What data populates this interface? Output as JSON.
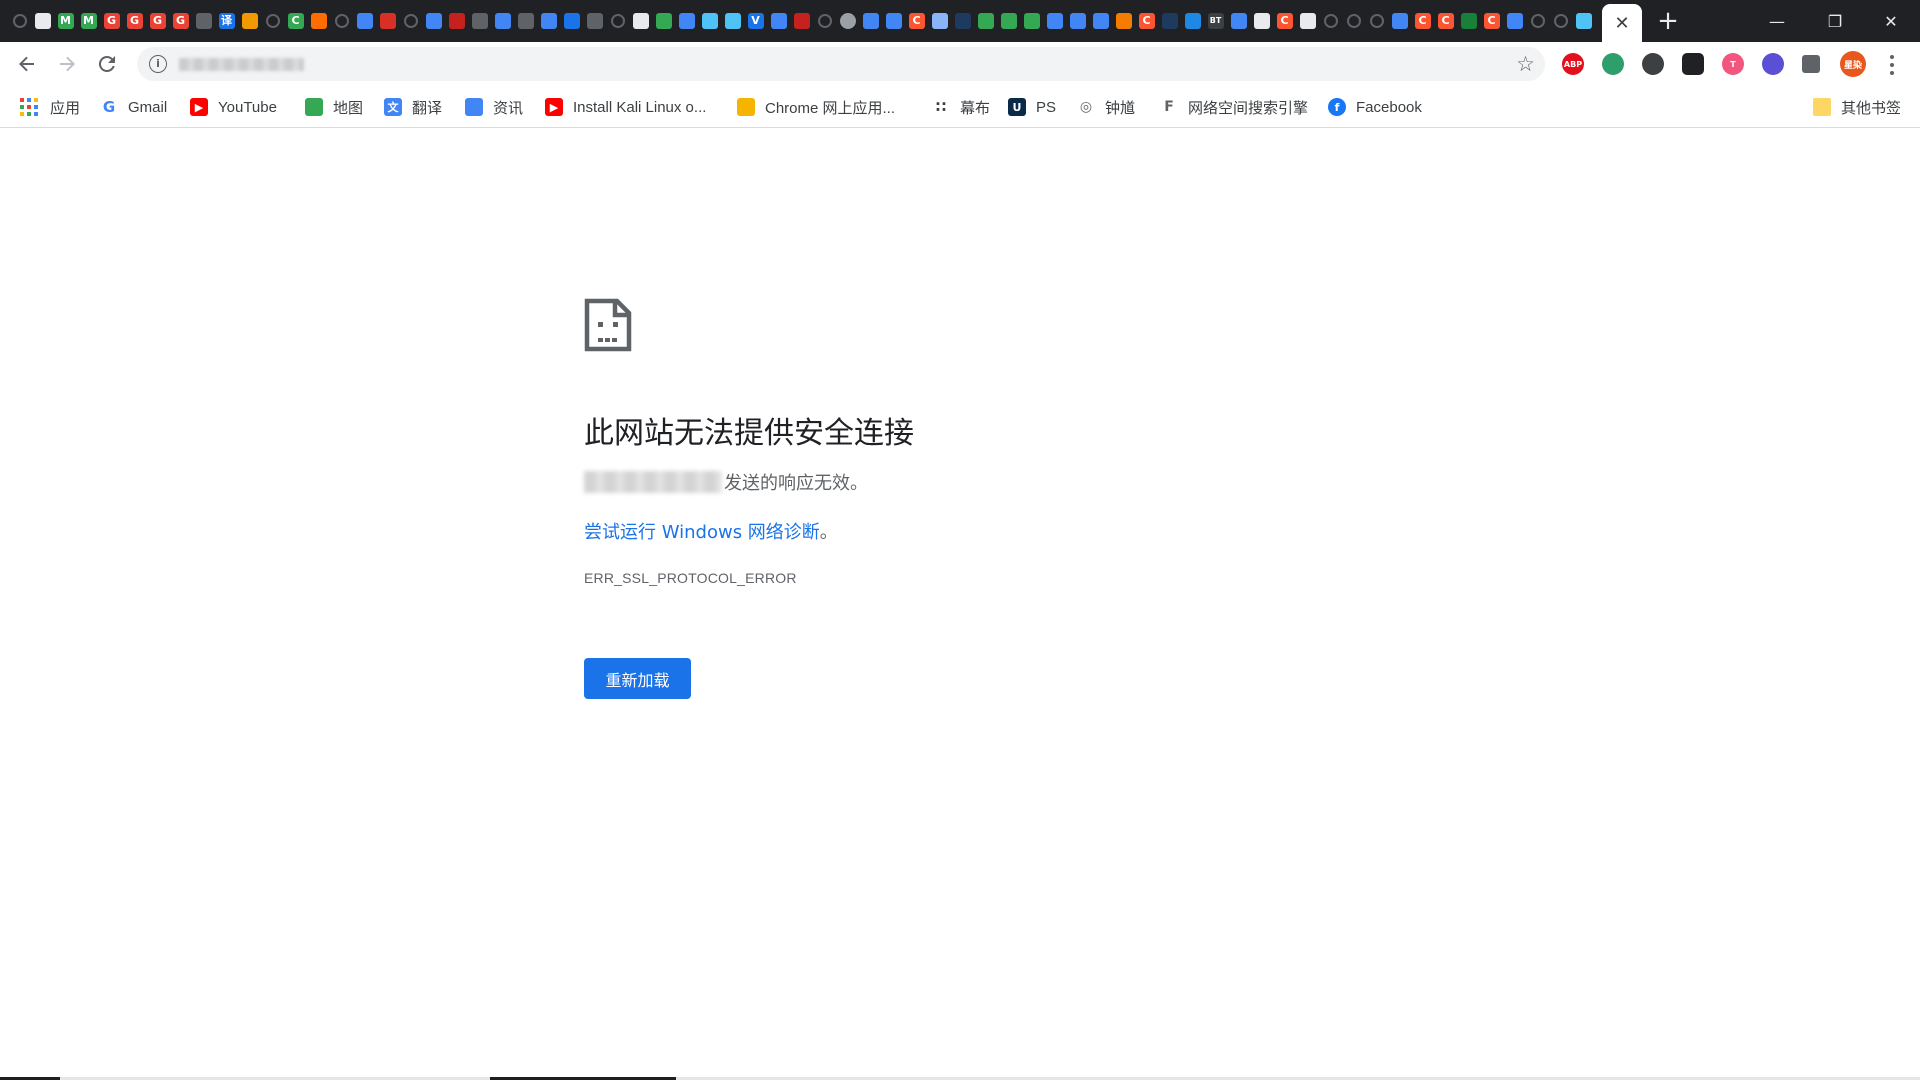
{
  "tabstrip": {
    "favicons": [
      {
        "name": "github-favicon",
        "color": "#3c4043",
        "glyph": ""
      },
      {
        "name": "site-favicon",
        "color": "#e8eaed",
        "glyph": ""
      },
      {
        "name": "m-favicon",
        "color": "#34a853",
        "glyph": "M"
      },
      {
        "name": "m-favicon",
        "color": "#34a853",
        "glyph": "M"
      },
      {
        "name": "g-favicon",
        "color": "#ea4335",
        "glyph": "G"
      },
      {
        "name": "g-favicon",
        "color": "#ea4335",
        "glyph": "G"
      },
      {
        "name": "g-favicon",
        "color": "#ea4335",
        "glyph": "G"
      },
      {
        "name": "g-favicon",
        "color": "#ea4335",
        "glyph": "G"
      },
      {
        "name": "site-favicon",
        "color": "#5f6368",
        "glyph": ""
      },
      {
        "name": "translate-favicon",
        "color": "#1a73e8",
        "glyph": "译"
      },
      {
        "name": "site-favicon",
        "color": "#f29900",
        "glyph": ""
      },
      {
        "name": "github-favicon",
        "color": "#3c4043",
        "glyph": ""
      },
      {
        "name": "c-favicon",
        "color": "#34a853",
        "glyph": "C"
      },
      {
        "name": "site-favicon",
        "color": "#ff6d00",
        "glyph": ""
      },
      {
        "name": "github-favicon",
        "color": "#3c4043",
        "glyph": ""
      },
      {
        "name": "site-favicon",
        "color": "#4285f4",
        "glyph": ""
      },
      {
        "name": "site-favicon",
        "color": "#d93025",
        "glyph": ""
      },
      {
        "name": "github-favicon",
        "color": "#3c4043",
        "glyph": ""
      },
      {
        "name": "site-favicon",
        "color": "#4285f4",
        "glyph": ""
      },
      {
        "name": "site-favicon",
        "color": "#c5221f",
        "glyph": ""
      },
      {
        "name": "site-favicon",
        "color": "#5f6368",
        "glyph": ""
      },
      {
        "name": "site-favicon",
        "color": "#4285f4",
        "glyph": ""
      },
      {
        "name": "site-favicon",
        "color": "#5f6368",
        "glyph": ""
      },
      {
        "name": "site-favicon",
        "color": "#4285f4",
        "glyph": ""
      },
      {
        "name": "site-favicon",
        "color": "#1a73e8",
        "glyph": ""
      },
      {
        "name": "site-favicon",
        "color": "#5f6368",
        "glyph": ""
      },
      {
        "name": "github-favicon",
        "color": "#3c4043",
        "glyph": ""
      },
      {
        "name": "site-favicon",
        "color": "#e8eaed",
        "glyph": ""
      },
      {
        "name": "site-favicon",
        "color": "#34a853",
        "glyph": ""
      },
      {
        "name": "site-favicon",
        "color": "#4285f4",
        "glyph": ""
      },
      {
        "name": "site-favicon",
        "color": "#4fc3f7",
        "glyph": ""
      },
      {
        "name": "site-favicon",
        "color": "#4fc3f7",
        "glyph": ""
      },
      {
        "name": "v-favicon",
        "color": "#1a73e8",
        "glyph": "V"
      },
      {
        "name": "site-favicon",
        "color": "#4285f4",
        "glyph": ""
      },
      {
        "name": "site-favicon",
        "color": "#c5221f",
        "glyph": ""
      },
      {
        "name": "github-favicon",
        "color": "#3c4043",
        "glyph": ""
      },
      {
        "name": "gear-favicon",
        "color": "#9aa0a6",
        "glyph": ""
      },
      {
        "name": "site-favicon",
        "color": "#4285f4",
        "glyph": ""
      },
      {
        "name": "site-favicon",
        "color": "#4285f4",
        "glyph": ""
      },
      {
        "name": "c-favicon",
        "color": "#fc5531",
        "glyph": "C"
      },
      {
        "name": "site-favicon",
        "color": "#8ab4f8",
        "glyph": ""
      },
      {
        "name": "site-favicon",
        "color": "#1e3a5f",
        "glyph": ""
      },
      {
        "name": "site-favicon",
        "color": "#34a853",
        "glyph": ""
      },
      {
        "name": "site-favicon",
        "color": "#34a853",
        "glyph": ""
      },
      {
        "name": "site-favicon",
        "color": "#34a853",
        "glyph": ""
      },
      {
        "name": "site-favicon",
        "color": "#4285f4",
        "glyph": ""
      },
      {
        "name": "site-favicon",
        "color": "#4285f4",
        "glyph": ""
      },
      {
        "name": "site-favicon",
        "color": "#4285f4",
        "glyph": ""
      },
      {
        "name": "site-favicon",
        "color": "#f57c00",
        "glyph": ""
      },
      {
        "name": "c-favicon",
        "color": "#fc5531",
        "glyph": "C"
      },
      {
        "name": "site-favicon",
        "color": "#1e3a5f",
        "glyph": ""
      },
      {
        "name": "site-favicon",
        "color": "#1e88e5",
        "glyph": ""
      },
      {
        "name": "bt-favicon",
        "color": "#3c4043",
        "glyph": "BT"
      },
      {
        "name": "site-favicon",
        "color": "#4285f4",
        "glyph": ""
      },
      {
        "name": "site-favicon",
        "color": "#e8eaed",
        "glyph": ""
      },
      {
        "name": "c-favicon",
        "color": "#fc5531",
        "glyph": "C"
      },
      {
        "name": "site-favicon",
        "color": "#e8eaed",
        "glyph": ""
      },
      {
        "name": "github-favicon",
        "color": "#3c4043",
        "glyph": ""
      },
      {
        "name": "github-favicon",
        "color": "#3c4043",
        "glyph": ""
      },
      {
        "name": "github-favicon",
        "color": "#3c4043",
        "glyph": ""
      },
      {
        "name": "site-favicon",
        "color": "#4285f4",
        "glyph": ""
      },
      {
        "name": "c-favicon",
        "color": "#fc5531",
        "glyph": "C"
      },
      {
        "name": "c-favicon",
        "color": "#fc5531",
        "glyph": "C"
      },
      {
        "name": "site-favicon",
        "color": "#188038",
        "glyph": ""
      },
      {
        "name": "c-favicon",
        "color": "#fc5531",
        "glyph": "C"
      },
      {
        "name": "site-favicon",
        "color": "#4285f4",
        "glyph": ""
      },
      {
        "name": "github-favicon",
        "color": "#3c4043",
        "glyph": ""
      },
      {
        "name": "github-favicon",
        "color": "#3c4043",
        "glyph": ""
      },
      {
        "name": "site-favicon",
        "color": "#4fc3f7",
        "glyph": ""
      }
    ],
    "active_tab_close": "✕",
    "new_tab": "+",
    "window_minimize": "—",
    "window_restore": "❐",
    "window_close": "✕"
  },
  "toolbar": {
    "extensions": [
      {
        "name": "adblock-plus-icon",
        "color": "#e40f1c",
        "label": "ABP"
      },
      {
        "name": "extension-green-icon",
        "color": "#2e9e6b",
        "label": ""
      },
      {
        "name": "extension-spy-icon",
        "color": "#3c4043",
        "label": ""
      },
      {
        "name": "extension-dark-icon",
        "color": "#202124",
        "label": ""
      },
      {
        "name": "extension-pink-icon",
        "color": "#f2557d",
        "label": "T"
      },
      {
        "name": "extension-purple-icon",
        "color": "#5b4fd6",
        "label": ""
      },
      {
        "name": "extensions-puzzle-icon",
        "color": "#5f6368",
        "label": ""
      },
      {
        "name": "profile-avatar",
        "color": "#e8571c",
        "label": "星染"
      }
    ]
  },
  "bookmarks": {
    "apps_label": "应用",
    "items": [
      {
        "label": "Gmail",
        "icon": "google-icon",
        "color": "#4285f4",
        "glyph": "G"
      },
      {
        "label": "YouTube",
        "icon": "youtube-icon",
        "color": "#ff0000",
        "glyph": "▶"
      },
      {
        "label": "地图",
        "icon": "maps-icon",
        "color": "#34a853",
        "glyph": ""
      },
      {
        "label": "翻译",
        "icon": "translate-icon",
        "color": "#4285f4",
        "glyph": "文"
      },
      {
        "label": "资讯",
        "icon": "news-icon",
        "color": "#4285f4",
        "glyph": ""
      },
      {
        "label": "Install Kali Linux o...",
        "icon": "youtube-icon",
        "color": "#ff0000",
        "glyph": "▶"
      },
      {
        "label": "Chrome 网上应用...",
        "icon": "chrome-store-icon",
        "color": "#f4b400",
        "glyph": ""
      },
      {
        "label": "幕布",
        "icon": "mubu-icon",
        "color": "#3c4043",
        "glyph": "∷"
      },
      {
        "label": "PS",
        "icon": "ps-icon",
        "color": "#0b2a4a",
        "glyph": "U"
      },
      {
        "label": "钟馗",
        "icon": "zoomeye-icon",
        "color": "#5f6368",
        "glyph": "◎"
      },
      {
        "label": "网络空间搜索引擎",
        "icon": "fofa-icon",
        "color": "#5f6368",
        "glyph": "F"
      },
      {
        "label": "Facebook",
        "icon": "facebook-icon",
        "color": "#1877f2",
        "glyph": "f"
      }
    ],
    "other_label": "其他书签"
  },
  "error": {
    "title": "此网站无法提供安全连接",
    "description_suffix": "发送的响应无效。",
    "link_text": "尝试运行 Windows 网络诊断",
    "link_suffix": "。",
    "code": "ERR_SSL_PROTOCOL_ERROR",
    "reload_label": "重新加载"
  }
}
